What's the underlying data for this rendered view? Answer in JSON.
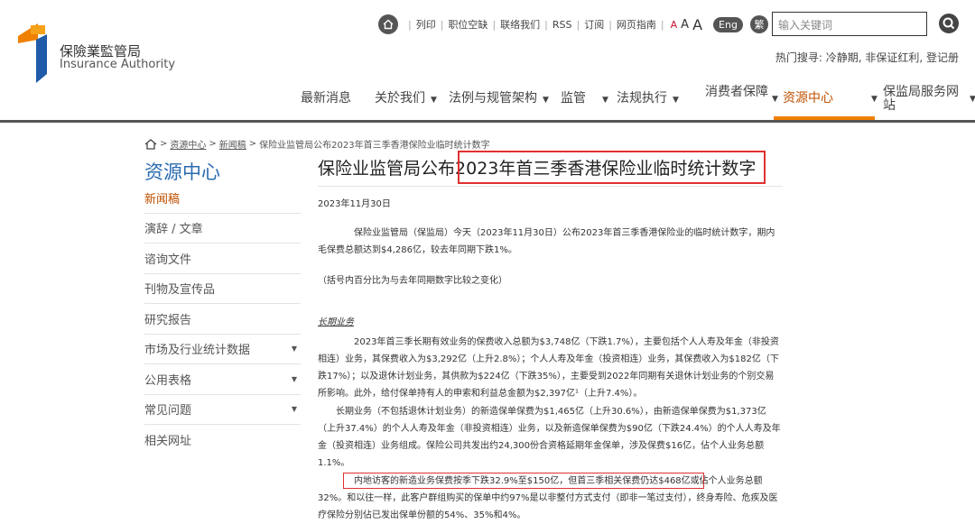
{
  "logo": {
    "zh": "保險業監管局",
    "en": "Insurance Authority"
  },
  "toplinks": [
    "列印",
    "职位空缺",
    "联络我们",
    "RSS",
    "订阅",
    "网页指南"
  ],
  "font_sizes": [
    "A",
    "A",
    "A"
  ],
  "lang": {
    "eng": "Eng",
    "trad": "繁"
  },
  "search": {
    "placeholder": "输入关键词"
  },
  "hot": "热门搜寻: 冷静期, 非保证红利, 登记册",
  "nav": [
    "最新消息",
    "关於我们",
    "法例与规管架构",
    "监管",
    "法规执行",
    "消费者保障",
    "资源中心",
    "保监局服务网站"
  ],
  "breadcrumb": {
    "link1": "资源中心",
    "link2": "新闻稿",
    "current": "保险业监管局公布2023年首三季香港保险业临时统计数字"
  },
  "sidebar": {
    "title": "资源中心",
    "items": [
      "新闻稿",
      "演辞 / 文章",
      "谘询文件",
      "刊物及宣传品",
      "研究报告",
      "市场及行业统计数据",
      "公用表格",
      "常见问题",
      "相关网址"
    ]
  },
  "article": {
    "title_a": "保险业监管局公布",
    "title_b": "2023年首三季香港保险业临时统计数字",
    "date": "2023年11月30日",
    "p1": "保险业监管局（保监局）今天（2023年11月30日）公布2023年首三季香港保险业的临时统计数字，期内毛保费总额达到$4,286亿，较去年同期下跌1%。",
    "p2": "（括号内百分比为与去年同期数字比较之变化）",
    "section": "长期业务",
    "p3": "2023年首三季长期有效业务的保费收入总额为$3,748亿（下跌1.7%），主要包括个人人寿及年金（非投资相连）业务，其保费收入为$3,292亿（上升2.8%）；个人人寿及年金（投资相连）业务，其保费收入为$182亿（下跌17%）；以及退休计划业务，其供款为$224亿（下跌35%），主要受到2022年同期有关退休计划业务的个别交易所影响。此外，给付保单持有人的申索和利益总金额为$2,397亿¹（上升7.4%）。",
    "p4": "长期业务（不包括退休计划业务）的新造保单保费为$1,465亿（上升30.6%），由新造保单保费为$1,373亿（上升37.4%）的个人人寿及年金（非投资相连）业务，以及新造保单保费为$90亿（下跌24.4%）的个人人寿及年金（投资相连）业务组成。保险公司共发出约24,300份合资格延期年金保单，涉及保费$16亿，佔个人业务总额1.1%。",
    "p5": "内地访客的新造业务保费按季下跌32.9%至$150亿，但首三季相关保费仍达$468亿或佔个人业务总额32%。和以往一样，此客户群组购买的保单中约97%是以非整付方式支付（即非一笔过支付），终身寿险、危疾及医疗保险分别佔已发出保单份额的54%、35%和4%。"
  }
}
